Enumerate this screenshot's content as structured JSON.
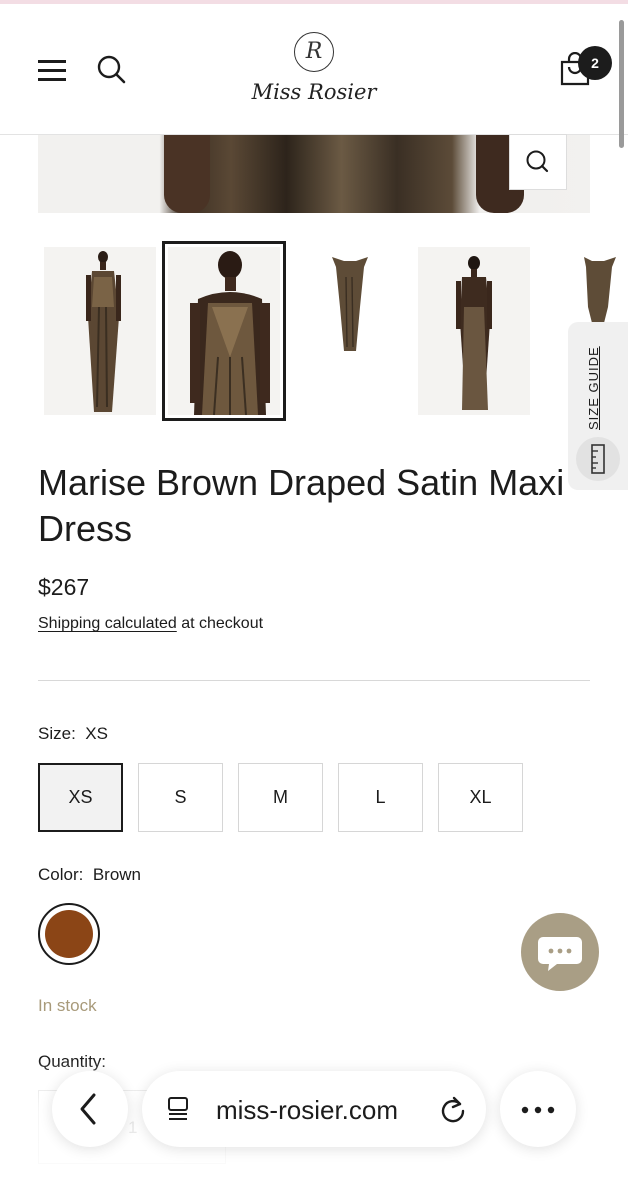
{
  "header": {
    "brand_monogram": "R",
    "brand_name": "Miss Rosier",
    "cart_count": "2"
  },
  "product": {
    "title": "Marise Brown Draped Satin Maxi Dress",
    "price": "$267",
    "shipping_link": "Shipping calculated",
    "shipping_rest": " at checkout",
    "size_label": "Size:",
    "size_selected": "XS",
    "sizes": [
      "XS",
      "S",
      "M",
      "L",
      "XL"
    ],
    "color_label": "Color:",
    "color_selected": "Brown",
    "color_hex": "#8b4516",
    "stock_status": "In stock",
    "quantity_label": "Quantity:",
    "quantity_value": "1"
  },
  "size_guide": {
    "label": "SIZE GUIDE"
  },
  "thumbnails": [
    {
      "name": "front-full",
      "selected": false
    },
    {
      "name": "front-closeup",
      "selected": true
    },
    {
      "name": "flat-dress",
      "selected": false
    },
    {
      "name": "back-full",
      "selected": false
    },
    {
      "name": "flat-dress-partial",
      "selected": false
    }
  ],
  "browser": {
    "url": "miss-rosier.com"
  },
  "colors": {
    "accent": "#1c1c1c",
    "stock": "#a89a7a",
    "chat_bubble": "#a99e85"
  }
}
